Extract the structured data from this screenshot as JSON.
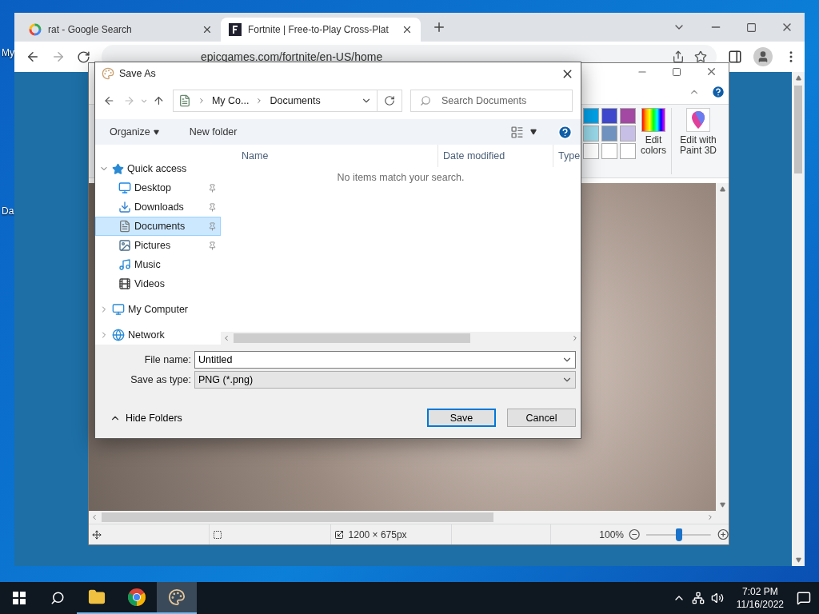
{
  "desktop": {
    "icons": [
      {
        "label": "My"
      },
      {
        "label": "Da"
      }
    ]
  },
  "browser": {
    "tabs": [
      {
        "title": "rat - Google Search",
        "kind": "google",
        "selected": false
      },
      {
        "title": "Fortnite | Free-to-Play Cross-Plat",
        "kind": "fortnite",
        "selected": true
      }
    ],
    "address": "epicgames.com/fortnite/en-US/home"
  },
  "paint": {
    "palette": [
      {
        "color": "#00a2e8"
      },
      {
        "color": "#3f48cc"
      },
      {
        "color": "#a349a4"
      },
      {
        "color": "#99d9ea"
      },
      {
        "color": "#7092be"
      },
      {
        "color": "#c8bfe7"
      },
      {
        "color": "#ffffff"
      },
      {
        "color": "#ffffff"
      },
      {
        "color": "#ffffff"
      }
    ],
    "ribbon_buttons": [
      {
        "label": "Edit colors",
        "kind": "spectrum"
      },
      {
        "label": "Edit with Paint 3D",
        "kind": "paint3d"
      }
    ],
    "status": {
      "dimensions": "1200 × 675px",
      "zoom": "100%"
    },
    "zoom_slider": {
      "level": 0.5
    }
  },
  "dialog": {
    "title": "Save As",
    "breadcrumb": [
      "My Co...",
      "Documents"
    ],
    "search": {
      "placeholder": "Search Documents"
    },
    "toolbar": {
      "organize": "Organize",
      "new_folder": "New folder"
    },
    "nav": [
      {
        "label": "Quick access",
        "kind": "star",
        "expanded": true,
        "selected": false,
        "children": [
          {
            "label": "Desktop",
            "kind": "desktop",
            "pinned": true,
            "selected": false
          },
          {
            "label": "Downloads",
            "kind": "download",
            "pinned": true,
            "selected": false
          },
          {
            "label": "Documents",
            "kind": "document",
            "pinned": true,
            "selected": true
          },
          {
            "label": "Pictures",
            "kind": "picture",
            "pinned": true,
            "selected": false
          },
          {
            "label": "Music",
            "kind": "music",
            "pinned": false,
            "selected": false
          },
          {
            "label": "Videos",
            "kind": "video",
            "pinned": false,
            "selected": false
          }
        ]
      },
      {
        "label": "My Computer",
        "kind": "computer",
        "expanded": false,
        "selected": false
      },
      {
        "label": "Network",
        "kind": "network",
        "expanded": false,
        "selected": false
      }
    ],
    "columns": [
      "Name",
      "Date modified",
      "Type"
    ],
    "empty_message": "No items match your search.",
    "fields": [
      {
        "label": "File name:",
        "value": "Untitled",
        "kind": "input"
      },
      {
        "label": "Save as type:",
        "value": "PNG (*.png)",
        "kind": "select"
      }
    ],
    "hide_folders": "Hide Folders",
    "buttons": [
      {
        "label": "Save",
        "default": true
      },
      {
        "label": "Cancel",
        "default": false
      }
    ]
  },
  "taskbar": {
    "apps": [
      {
        "kind": "explorer",
        "selected": false
      },
      {
        "kind": "chrome",
        "selected": false
      },
      {
        "kind": "paint",
        "selected": true
      }
    ],
    "time": "7:02 PM",
    "date": "11/16/2022"
  }
}
